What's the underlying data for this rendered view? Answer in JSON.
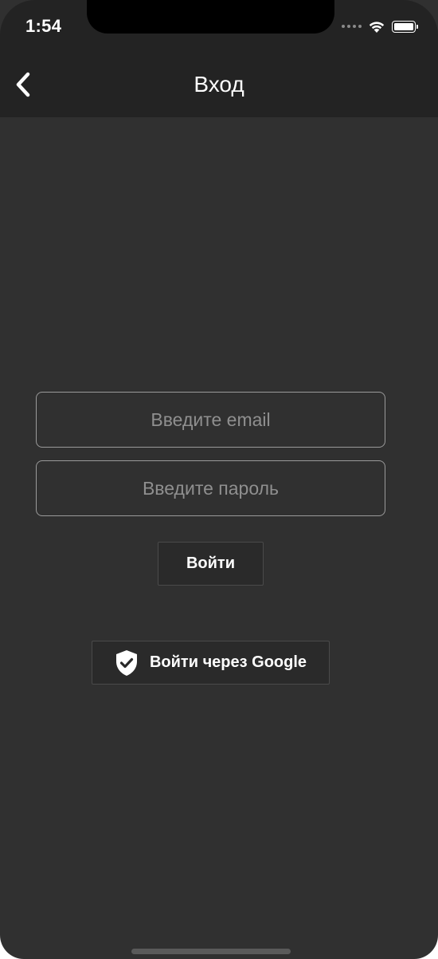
{
  "status_bar": {
    "time": "1:54"
  },
  "nav": {
    "back_icon": "chevron-left-icon",
    "title": "Вход"
  },
  "form": {
    "email_placeholder": "Введите email",
    "email_value": "",
    "password_placeholder": "Введите пароль",
    "password_value": "",
    "login_label": "Войти",
    "google_label": "Войти через Google",
    "google_icon": "shield-check-icon"
  },
  "colors": {
    "background": "#303030",
    "header": "#232323",
    "field_border": "#9a9a9a",
    "placeholder": "#8f8f8f",
    "text": "#ffffff"
  }
}
